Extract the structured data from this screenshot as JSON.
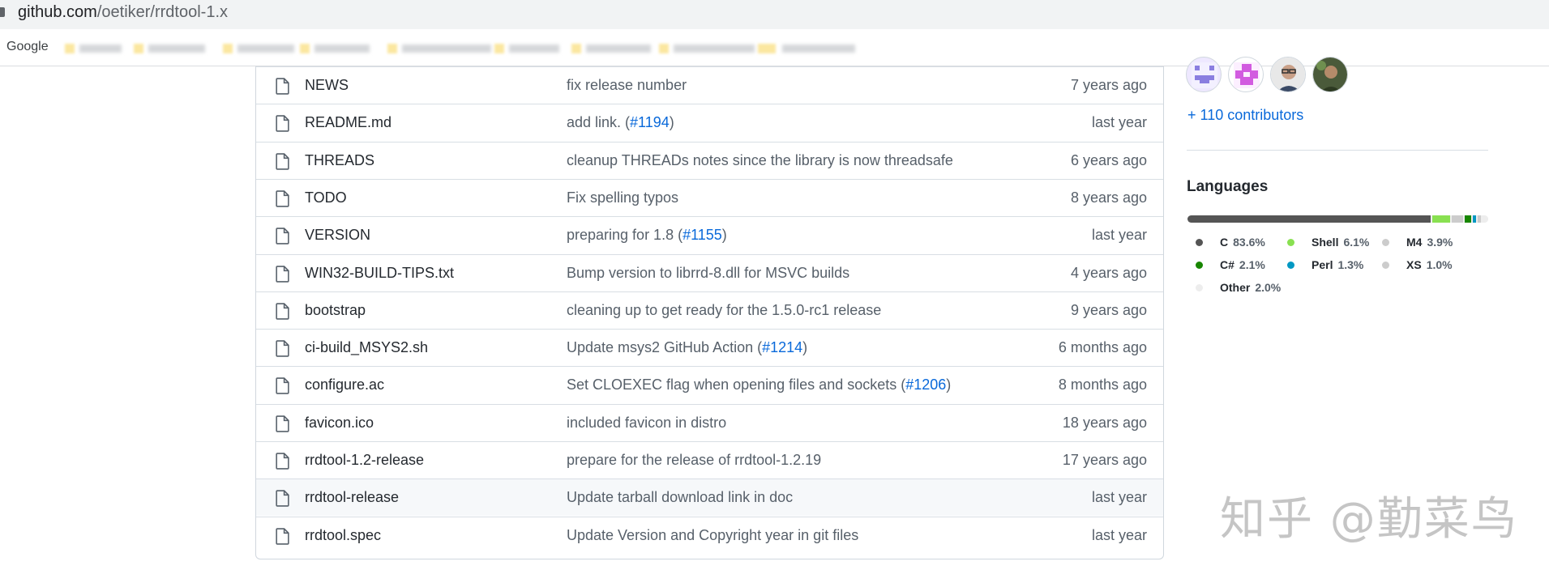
{
  "browser": {
    "url_domain": "github.com",
    "url_path": "/oetiker/rrdtool-1.x",
    "bookmark_first": "Google"
  },
  "files": [
    {
      "name": "NEWS",
      "commit": "fix release number",
      "pr": "",
      "commit_tail": "",
      "age": "7 years ago"
    },
    {
      "name": "README.md",
      "commit": "add link. (",
      "pr": "#1194",
      "commit_tail": ")",
      "age": "last year"
    },
    {
      "name": "THREADS",
      "commit": "cleanup THREADs notes since the library is now threadsafe",
      "pr": "",
      "commit_tail": "",
      "age": "6 years ago"
    },
    {
      "name": "TODO",
      "commit": "Fix spelling typos",
      "pr": "",
      "commit_tail": "",
      "age": "8 years ago"
    },
    {
      "name": "VERSION",
      "commit": "preparing for 1.8 (",
      "pr": "#1155",
      "commit_tail": ")",
      "age": "last year"
    },
    {
      "name": "WIN32-BUILD-TIPS.txt",
      "commit": "Bump version to librrd-8.dll for MSVC builds",
      "pr": "",
      "commit_tail": "",
      "age": "4 years ago"
    },
    {
      "name": "bootstrap",
      "commit": "cleaning up to get ready for the 1.5.0-rc1 release",
      "pr": "",
      "commit_tail": "",
      "age": "9 years ago"
    },
    {
      "name": "ci-build_MSYS2.sh",
      "commit": "Update msys2 GitHub Action (",
      "pr": "#1214",
      "commit_tail": ")",
      "age": "6 months ago"
    },
    {
      "name": "configure.ac",
      "commit": "Set CLOEXEC flag when opening files and sockets (",
      "pr": "#1206",
      "commit_tail": ")",
      "age": "8 months ago"
    },
    {
      "name": "favicon.ico",
      "commit": "included favicon in distro",
      "pr": "",
      "commit_tail": "",
      "age": "18 years ago"
    },
    {
      "name": "rrdtool-1.2-release",
      "commit": "prepare for the release of rrdtool-1.2.19",
      "pr": "",
      "commit_tail": "",
      "age": "17 years ago"
    },
    {
      "name": "rrdtool-release",
      "commit": "Update tarball download link in doc",
      "pr": "",
      "commit_tail": "",
      "age": "last year"
    },
    {
      "name": "rrdtool.spec",
      "commit": "Update Version and Copyright year in git files",
      "pr": "",
      "commit_tail": "",
      "age": "last year"
    }
  ],
  "sidebar": {
    "contributors_link": "+ 110 contributors",
    "languages_heading": "Languages",
    "languages": [
      {
        "name": "C",
        "pct": "83.6%",
        "value": 83.6,
        "color": "#555555"
      },
      {
        "name": "Shell",
        "pct": "6.1%",
        "value": 6.1,
        "color": "#89e051"
      },
      {
        "name": "M4",
        "pct": "3.9%",
        "value": 3.9,
        "color": "#cccccc"
      },
      {
        "name": "C#",
        "pct": "2.1%",
        "value": 2.1,
        "color": "#178600"
      },
      {
        "name": "Perl",
        "pct": "1.3%",
        "value": 1.3,
        "color": "#0298c3"
      },
      {
        "name": "XS",
        "pct": "1.0%",
        "value": 1.0,
        "color": "#cccccc"
      },
      {
        "name": "Other",
        "pct": "2.0%",
        "value": 2.0,
        "color": "#ededed"
      }
    ]
  },
  "watermark": "知乎 @勤菜鸟"
}
